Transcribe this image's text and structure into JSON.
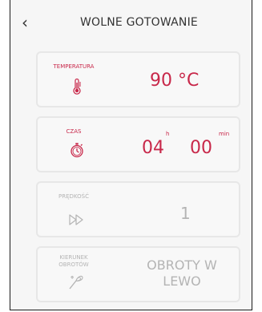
{
  "header": {
    "title": "WOLNE GOTOWANIE"
  },
  "cards": [
    {
      "label": "TEMPERATURA",
      "value": "90 °C",
      "icon": "thermometer-icon"
    },
    {
      "label": "CZAS",
      "hours": "04",
      "hours_unit": "h",
      "minutes": "00",
      "minutes_unit": "min",
      "icon": "timer-icon"
    },
    {
      "label": "PRĘDKOŚĆ",
      "value": "1",
      "icon": "speed-icon"
    },
    {
      "label_lines": [
        "KIERUNEK",
        "OBROTÓW"
      ],
      "value_lines": [
        "OBROTY W",
        "LEWO"
      ],
      "icon": "whisk-icon"
    }
  ],
  "colors": {
    "accent": "#c8284a",
    "disabled": "#b4b4b4"
  }
}
